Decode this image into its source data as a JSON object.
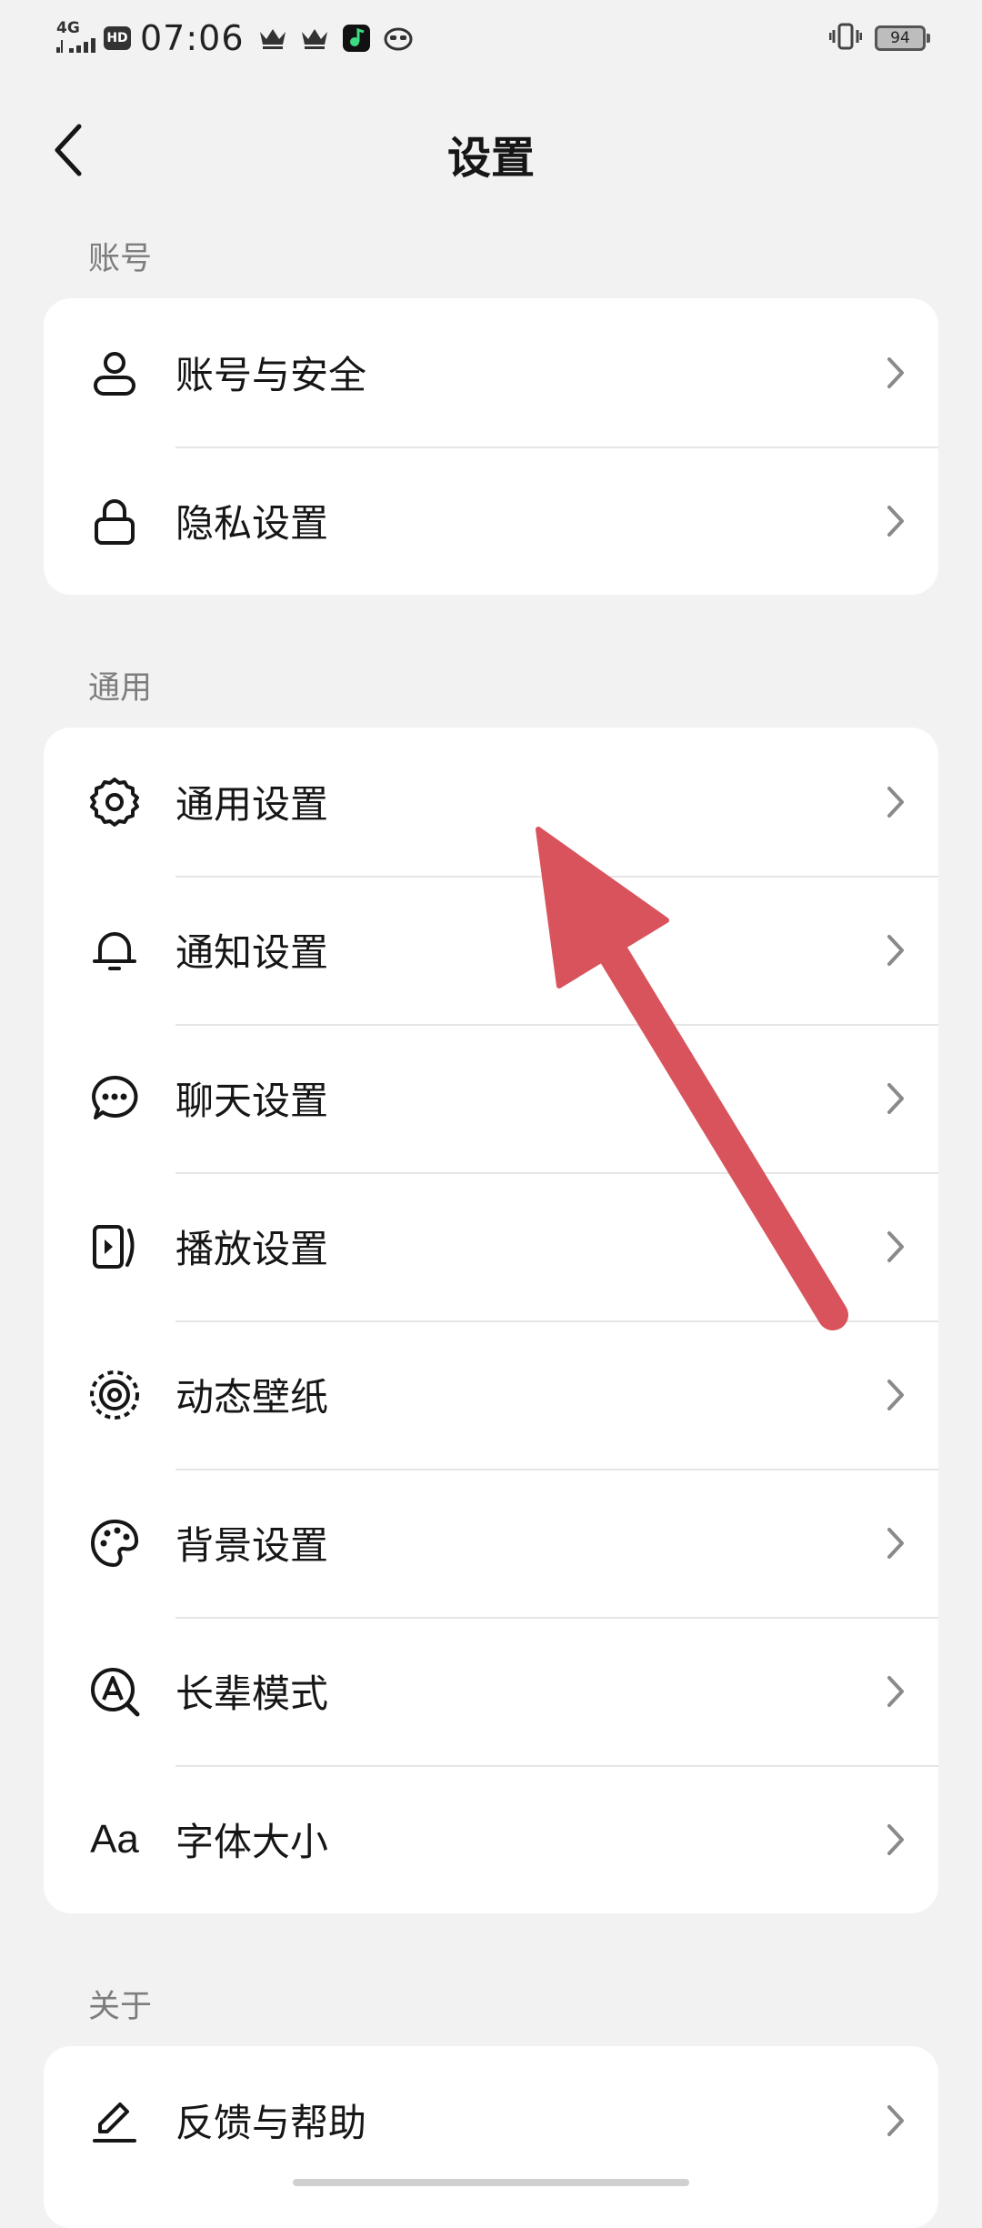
{
  "status_bar": {
    "network": "4G",
    "hd": "HD",
    "time": "07:06",
    "battery": "94"
  },
  "header": {
    "title": "设置"
  },
  "sections": {
    "account": {
      "label": "账号",
      "items": [
        {
          "label": "账号与安全",
          "icon": "user-icon"
        },
        {
          "label": "隐私设置",
          "icon": "lock-icon"
        }
      ]
    },
    "general": {
      "label": "通用",
      "items": [
        {
          "label": "通用设置",
          "icon": "gear-icon"
        },
        {
          "label": "通知设置",
          "icon": "bell-icon"
        },
        {
          "label": "聊天设置",
          "icon": "chat-bubble-icon"
        },
        {
          "label": "播放设置",
          "icon": "play-icon"
        },
        {
          "label": "动态壁纸",
          "icon": "wallpaper-icon"
        },
        {
          "label": "背景设置",
          "icon": "palette-icon"
        },
        {
          "label": "长辈模式",
          "icon": "elder-mode-icon"
        },
        {
          "label": "字体大小",
          "icon": "font-size-icon",
          "glyph": "Aa"
        }
      ]
    },
    "about": {
      "label": "关于",
      "items": [
        {
          "label": "反馈与帮助",
          "icon": "pencil-icon"
        }
      ]
    }
  },
  "colors": {
    "background": "#f2f2f2",
    "card": "#ffffff",
    "arrow": "#d9535d",
    "section_label": "#7d7d7d"
  }
}
